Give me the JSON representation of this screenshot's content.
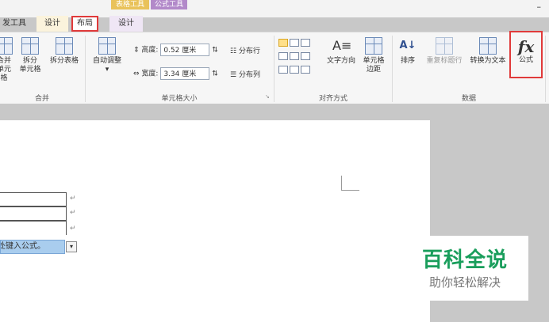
{
  "context_headers": {
    "table_tools": "表格工具",
    "formula_tools": "公式工具"
  },
  "tabs": {
    "developer": "发工具",
    "design": "设计",
    "layout": "布局",
    "formula_design": "设计"
  },
  "window": {
    "minimize": "–"
  },
  "ribbon": {
    "merge_group": {
      "label": "合并",
      "merge_cells": [
        "合并",
        "单元格"
      ],
      "split_cells": [
        "拆分",
        "单元格"
      ],
      "split_table": "拆分表格"
    },
    "cell_size_group": {
      "label": "单元格大小",
      "autofit": "自动调整",
      "height_label": "高度:",
      "height_value": "0.52 厘米",
      "width_label": "宽度:",
      "width_value": "3.34 厘米",
      "distribute_rows": "分布行",
      "distribute_cols": "分布列"
    },
    "alignment_group": {
      "label": "对齐方式",
      "text_direction": "文字方向",
      "cell_margins": [
        "单元格",
        "边距"
      ]
    },
    "data_group": {
      "label": "数据",
      "sort": "排序",
      "repeat_header": "重复标题行",
      "convert_to_text": "转换为文本",
      "formula": "公式",
      "formula_icon": "fx"
    }
  },
  "document": {
    "paragraph_mark": "↵",
    "formula_field_text": "此处键入公式。",
    "dropdown_glyph": "▾"
  },
  "watermark": {
    "title": "百科全说",
    "subtitle": "助你轻松解决"
  }
}
